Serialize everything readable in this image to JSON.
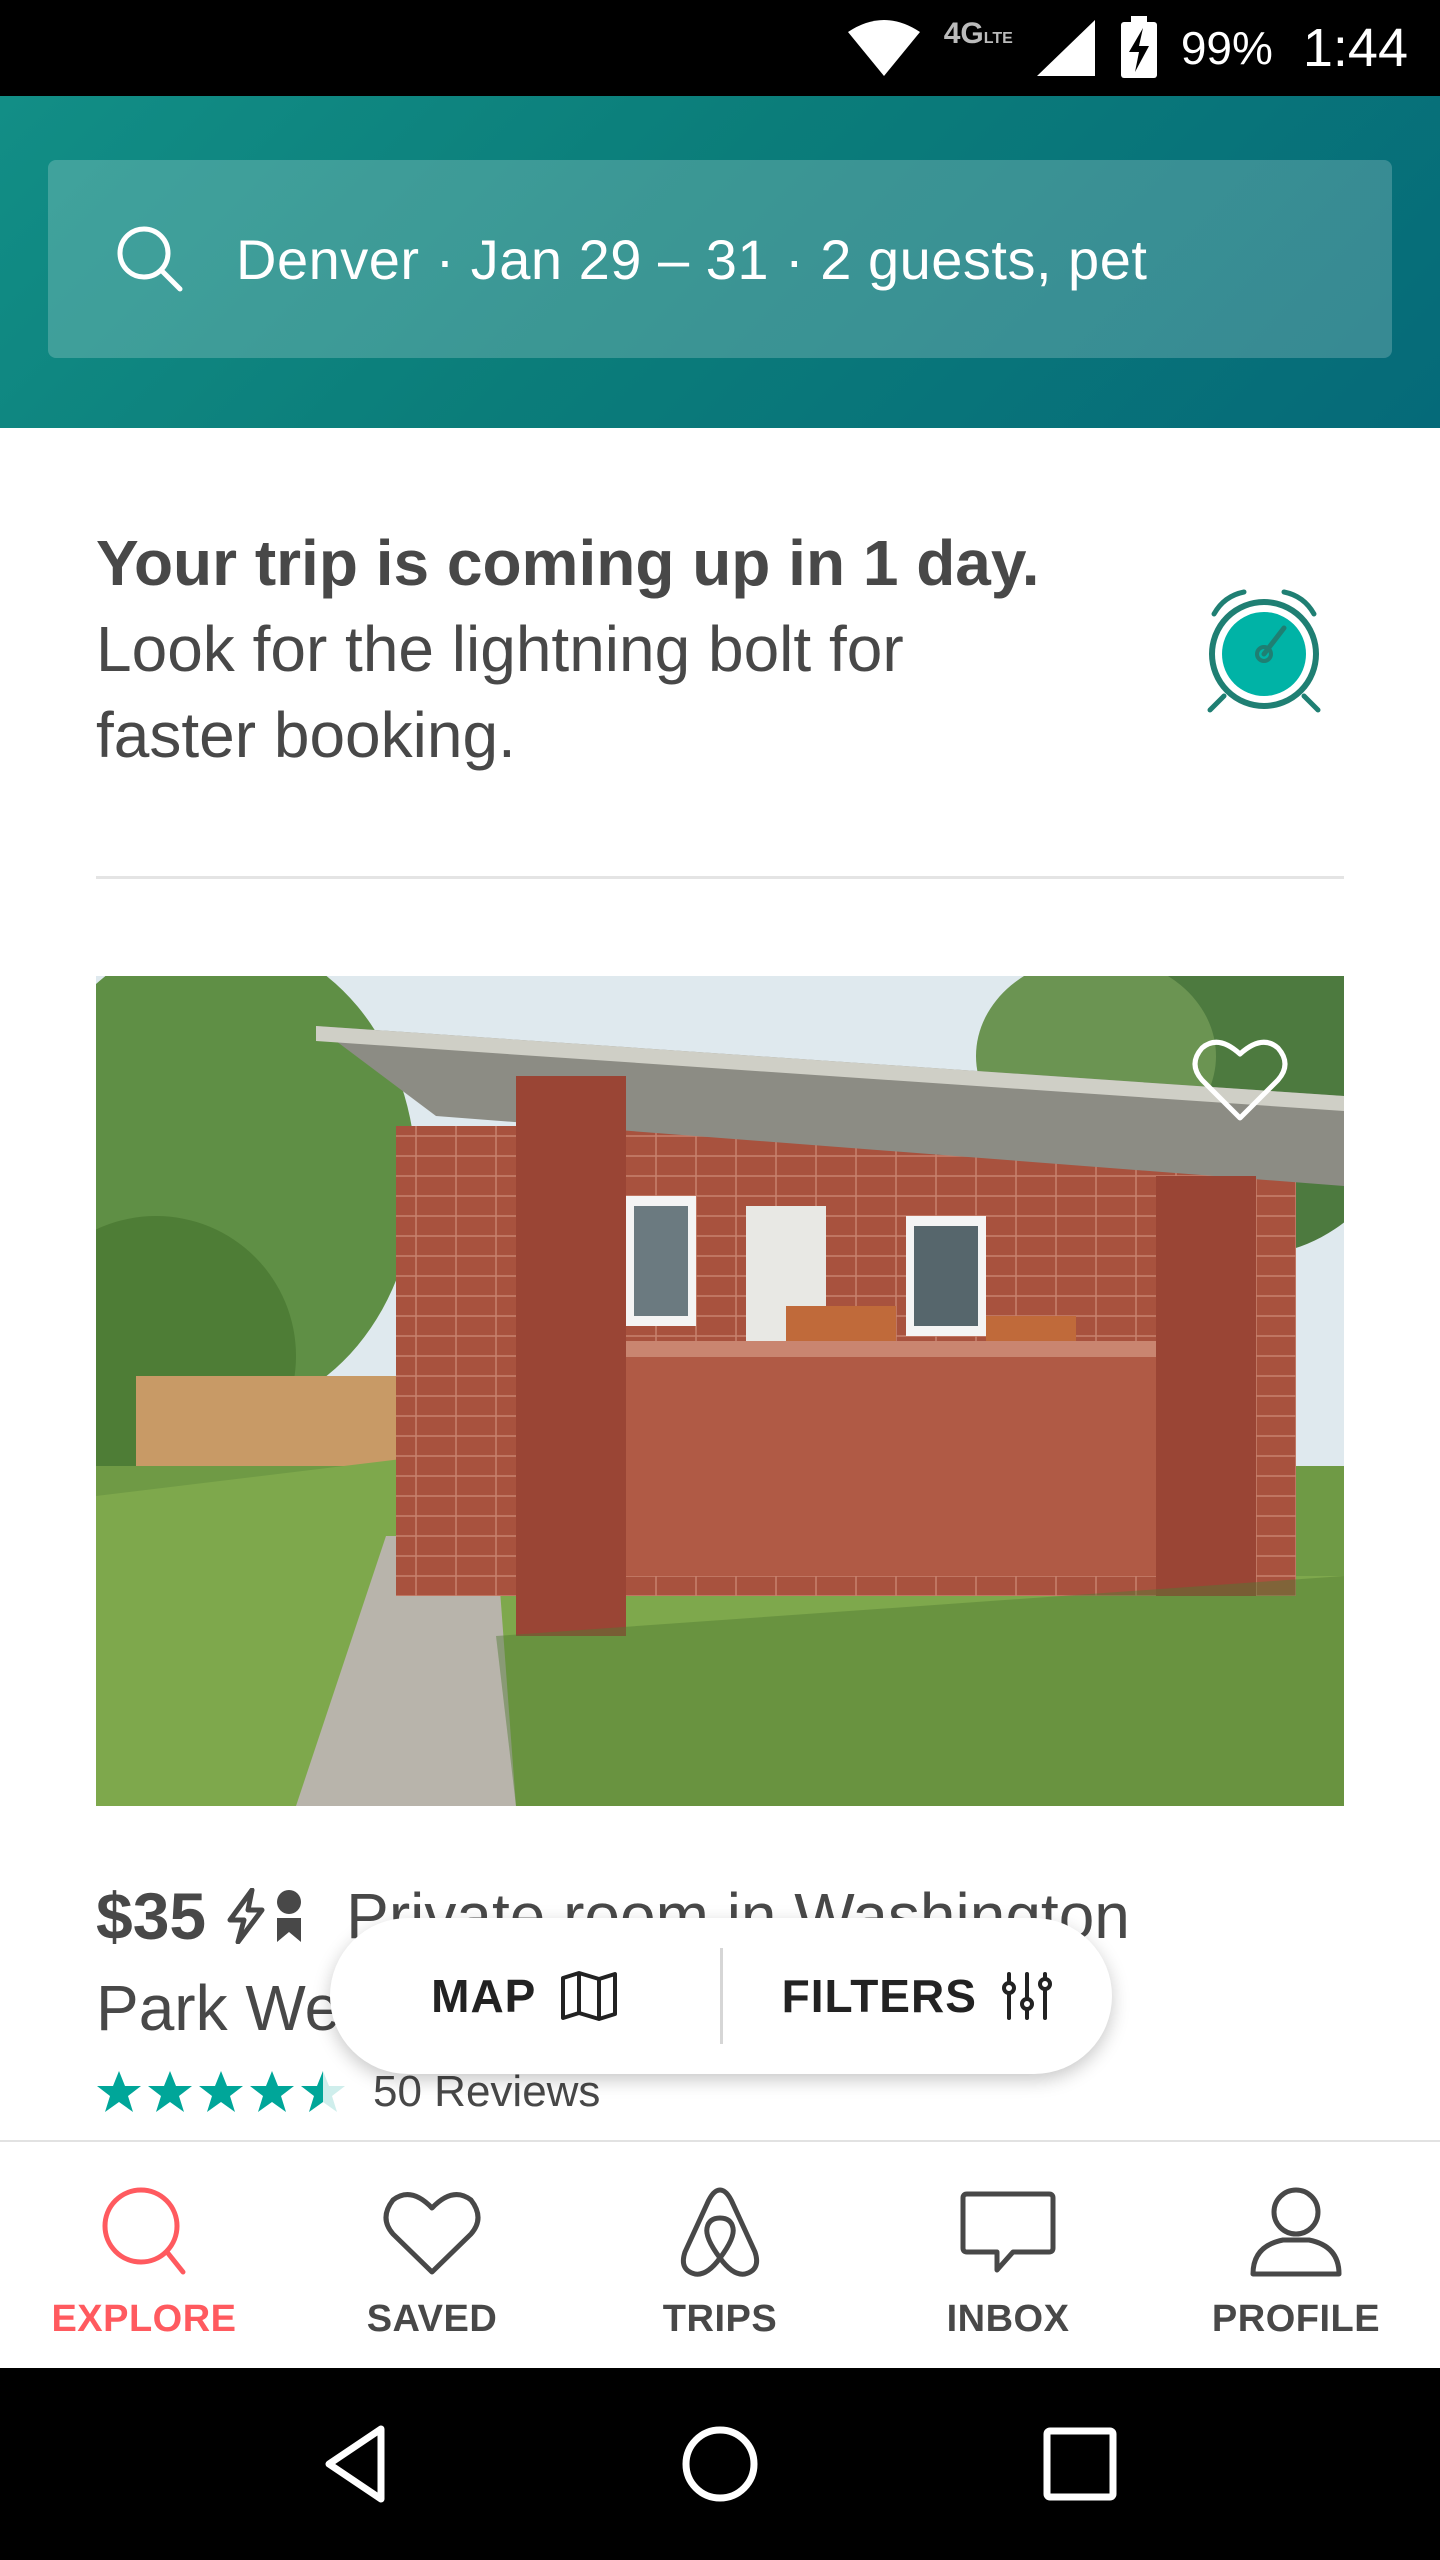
{
  "status_bar": {
    "network": "4G",
    "network_sub": "LTE",
    "battery": "99%",
    "time": "1:44"
  },
  "search": {
    "text": "Denver · Jan 29 – 31 · 2 guests, pet",
    "icon": "search-icon"
  },
  "banner": {
    "title": "Your trip is coming up in 1 day.",
    "subtitle_line1": "Look for the lightning bolt for",
    "subtitle_line2": "faster booking.",
    "icon": "alarm-clock-icon",
    "accent_color": "#00a699"
  },
  "listing": {
    "price": "$35",
    "title_line1": "Private room in Washington",
    "title_line2": "Park West",
    "rating_stars": 4.5,
    "reviews": "50 Reviews",
    "star_color": "#00a699",
    "saved": false
  },
  "floating_actions": {
    "map_label": "MAP",
    "filters_label": "FILTERS"
  },
  "bottom_nav": {
    "items": [
      {
        "label": "EXPLORE",
        "icon": "search-icon",
        "active": true
      },
      {
        "label": "SAVED",
        "icon": "heart-icon",
        "active": false
      },
      {
        "label": "TRIPS",
        "icon": "airbnb-logo-icon",
        "active": false
      },
      {
        "label": "INBOX",
        "icon": "chat-bubble-icon",
        "active": false
      },
      {
        "label": "PROFILE",
        "icon": "person-icon",
        "active": false
      }
    ],
    "active_color": "#ff5a5f"
  },
  "colors": {
    "brand_teal": "#0b7d7a",
    "brand_red": "#ff5a5f"
  }
}
